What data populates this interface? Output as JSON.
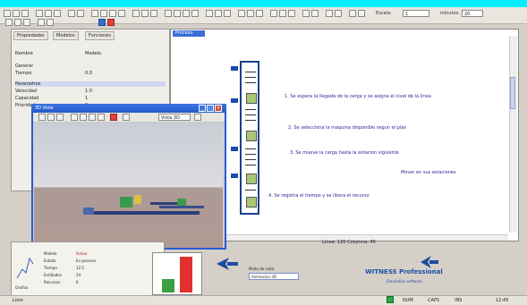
{
  "toolbar": {
    "scale_label": "Escala:",
    "scale_value": "1",
    "minutes_label": "minutos:",
    "minutes_value": "20"
  },
  "left_panel": {
    "tabs": [
      "Propiedades",
      "Modelos",
      "Funciones"
    ],
    "rows": [
      {
        "label": "Nombre",
        "value": "Modelo"
      },
      {
        "label": "General",
        "value": ""
      },
      {
        "label": "Tiempo",
        "value": "0.0"
      },
      {
        "label": "Parametros",
        "value": ""
      },
      {
        "label": "Velocidad",
        "value": "1.0"
      },
      {
        "label": "Capacidad",
        "value": "1"
      },
      {
        "label": "Prioridad",
        "value": "0"
      }
    ]
  },
  "editor": {
    "tab_label": "Proceso",
    "steps": [
      "1. Se espera la llegada de la carga y se asigna el nivel de la linea",
      "2. Se selecciona la maquina disponible segun el plan",
      "3. Se mueve la carga hasta la estacion siguiente",
      "Mover en sus estaciones",
      "4. Se registra el tiempo y se libera el recurso"
    ],
    "status": "Linea: 120   Columna: 45"
  },
  "sim_window": {
    "title": "3D View",
    "view_dropdown": "Vista 3D"
  },
  "bottom_panel": {
    "labels": [
      "Modelo",
      "Estado",
      "Tiempo",
      "Entidades",
      "Recursos"
    ],
    "values": [
      "Activo",
      "En proceso",
      "12.5",
      "24",
      "6"
    ],
    "left_caption": "Grafico",
    "chart_values": [
      35,
      95
    ],
    "chart_colors": [
      "#3aa040",
      "#e03030"
    ]
  },
  "mode": {
    "label": "Modo de vista:",
    "value": "Animacion 3D"
  },
  "brand": {
    "name": "WITNESS Professional",
    "subtitle": "Simulation software"
  },
  "statusbar": {
    "left": "Listo",
    "items": [
      "NUM",
      "CAPS",
      "INS",
      "12:45"
    ]
  }
}
